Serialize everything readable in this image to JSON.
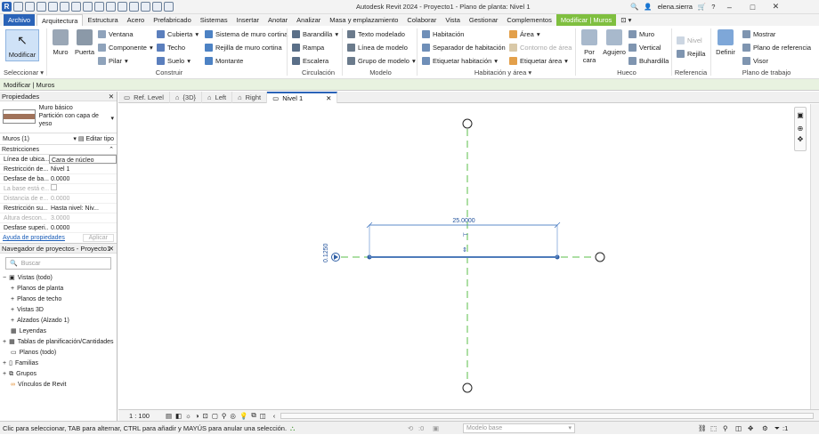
{
  "app": {
    "title": "Autodesk Revit 2024 - Proyecto1 - Plano de planta: Nivel 1",
    "user": "elena.sierra"
  },
  "tabs": [
    "Archivo",
    "Arquitectura",
    "Estructura",
    "Acero",
    "Prefabricado",
    "Sistemas",
    "Insertar",
    "Anotar",
    "Analizar",
    "Masa y emplazamiento",
    "Colaborar",
    "Vista",
    "Gestionar",
    "Complementos",
    "Modificar | Muros"
  ],
  "ribbon": {
    "modificar": "Modificar",
    "seleccionar": "Seleccionar",
    "muro": "Muro",
    "puerta": "Puerta",
    "ventana": "Ventana",
    "componente": "Componente",
    "pilar": "Pilar",
    "cubierta": "Cubierta",
    "techo": "Techo",
    "suelo": "Suelo",
    "sistema_muro": "Sistema de muro cortina",
    "rejilla_muro": "Rejilla de muro cortina",
    "montante": "Montante",
    "construir": "Construir",
    "barandilla": "Barandilla",
    "rampa": "Rampa",
    "escalera": "Escalera",
    "circulacion": "Circulación",
    "texto_modelado": "Texto modelado",
    "linea_modelo": "Línea de modelo",
    "grupo_modelo": "Grupo de modelo",
    "modelo": "Modelo",
    "habitacion": "Habitación",
    "separador": "Separador de habitación",
    "etiquetar_hab": "Etiquetar habitación",
    "area": "Área",
    "contorno_area": "Contorno de área",
    "etiquetar_area": "Etiquetar área",
    "hab_area": "Habitación y área",
    "por_cara": "Por cara",
    "agujero": "Agujero",
    "muro_h": "Muro",
    "vertical": "Vertical",
    "buhardilla": "Buhardilla",
    "hueco": "Hueco",
    "nivel": "Nivel",
    "rejilla": "Rejilla",
    "referencia": "Referencia",
    "definir": "Definir",
    "mostrar": "Mostrar",
    "plano_ref": "Plano de referencia",
    "visor": "Visor",
    "plano_trabajo": "Plano de trabajo"
  },
  "modbar": "Modificar | Muros",
  "properties": {
    "header": "Propiedades",
    "type_line1": "Muro básico",
    "type_line2": "Partición con capa de yeso",
    "selector": "Muros (1)",
    "edit_type": "Editar tipo",
    "group": "Restricciones",
    "rows": [
      {
        "k": "Línea de ubica...",
        "v": "Cara de núcleo"
      },
      {
        "k": "Restricción de...",
        "v": "Nivel 1"
      },
      {
        "k": "Desfase de ba...",
        "v": "0.0000"
      },
      {
        "k": "La base está e...",
        "v": ""
      },
      {
        "k": "Distancia de e...",
        "v": "0.0000"
      },
      {
        "k": "Restricción su...",
        "v": "Hasta nivel: Niv..."
      },
      {
        "k": "Altura descon...",
        "v": "3.0000"
      },
      {
        "k": "Desfase superi...",
        "v": "0.0000"
      }
    ],
    "help": "Ayuda de propiedades",
    "apply": "Aplicar"
  },
  "browser": {
    "header": "Navegador de proyectos - Proyecto1",
    "search": "Buscar",
    "items": [
      "Vistas (todo)",
      "Planos de planta",
      "Planos de techo",
      "Vistas 3D",
      "Alzados (Alzado 1)",
      "Leyendas",
      "Tablas de planificación/Cantidades",
      "Planos (todo)",
      "Familias",
      "Grupos",
      "Vínculos de Revit"
    ]
  },
  "viewtabs": [
    "Ref. Level",
    "{3D}",
    "Left",
    "Right",
    "Nivel 1"
  ],
  "canvas": {
    "dimension": "25.0000",
    "side_dim": "0.1250"
  },
  "viewbar": {
    "scale": "1 : 100"
  },
  "status": {
    "text": "Clic para seleccionar, TAB para alternar, CTRL para añadir y MAYÚS para anular una selección.",
    "model": "Modelo base",
    "zero": ":0",
    "filter": ":1"
  }
}
